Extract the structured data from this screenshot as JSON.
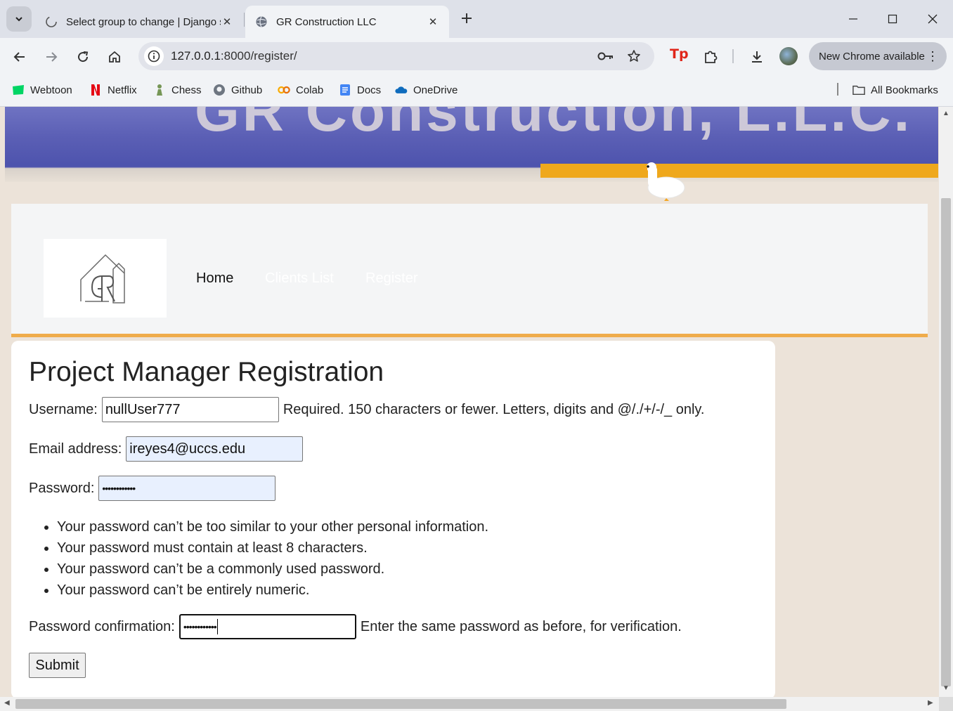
{
  "browser": {
    "tabs": [
      {
        "title": "Select group to change | Django site admin",
        "active": false,
        "icon": "loading-icon"
      },
      {
        "title": "GR Construction LLC",
        "active": true,
        "icon": "globe-icon"
      }
    ],
    "url_host": "127.0.0.1",
    "url_path": ":8000/register/",
    "update_label": "New Chrome available",
    "bookmarks": [
      {
        "label": "Webtoon",
        "icon": "webtoon-icon",
        "color": "#00d564"
      },
      {
        "label": "Netflix",
        "icon": "netflix-icon",
        "color": "#e50914"
      },
      {
        "label": "Chess",
        "icon": "chess-icon",
        "color": "#769656"
      },
      {
        "label": "Github",
        "icon": "github-icon",
        "color": "#6e7681"
      },
      {
        "label": "Colab",
        "icon": "colab-icon",
        "color": "#f9ab00"
      },
      {
        "label": "Docs",
        "icon": "docs-icon",
        "color": "#4285f4"
      },
      {
        "label": "OneDrive",
        "icon": "onedrive-icon",
        "color": "#0f6cbd"
      }
    ],
    "all_bookmarks_label": "All Bookmarks"
  },
  "site": {
    "nav": {
      "home": "Home",
      "clients": "Clients List",
      "register": "Register"
    },
    "accent_color": "#efac4b"
  },
  "form": {
    "title": "Project Manager Registration",
    "username": {
      "label": "Username:",
      "value": "nullUser777",
      "help": "Required. 150 characters or fewer. Letters, digits and @/./+/-/_ only."
    },
    "email": {
      "label": "Email address:",
      "value": "ireyes4@uccs.edu"
    },
    "password": {
      "label": "Password:",
      "value": "••••••••••••"
    },
    "password_rules": [
      "Your password can’t be too similar to your other personal information.",
      "Your password must contain at least 8 characters.",
      "Your password can’t be a commonly used password.",
      "Your password can’t be entirely numeric."
    ],
    "password_confirm": {
      "label": "Password confirmation:",
      "value": "••••••••••••",
      "help": "Enter the same password as before, for verification."
    },
    "submit_label": "Submit"
  }
}
